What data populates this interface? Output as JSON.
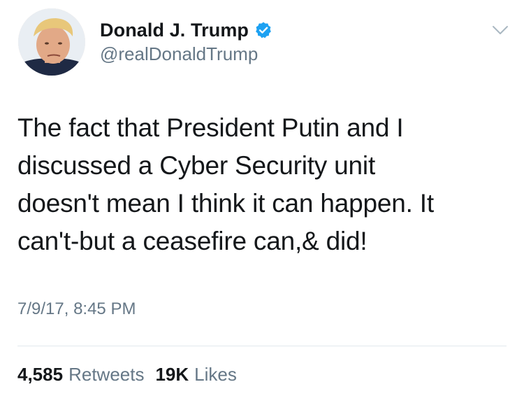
{
  "author": {
    "display_name": "Donald J. Trump",
    "handle": "@realDonaldTrump",
    "verified": true,
    "verified_color": "#1da1f2"
  },
  "tweet": {
    "text_lines": [
      "The fact that President Putin and I",
      "discussed a Cyber Security unit",
      "doesn't mean I think it can happen. It",
      "can't-but a ceasefire can,& did!"
    ],
    "timestamp": "7/9/17, 8:45 PM"
  },
  "stats": {
    "retweets_count": "4,585",
    "retweets_label": "Retweets",
    "likes_count": "19K",
    "likes_label": "Likes"
  },
  "icons": {
    "verified": "verified-badge-icon",
    "menu": "chevron-down-icon"
  }
}
